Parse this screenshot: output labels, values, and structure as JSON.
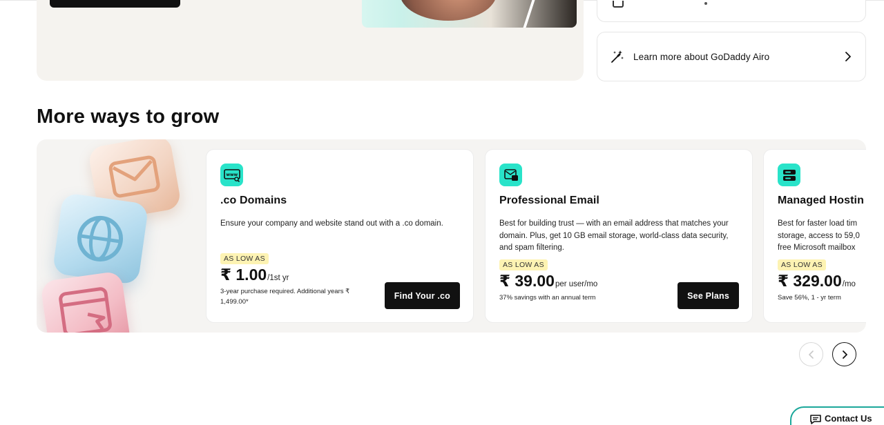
{
  "side": {
    "learn_label": "Learn more about GoDaddy Airo"
  },
  "section_title": "More ways to grow",
  "products": [
    {
      "name": ".co Domains",
      "icon": "www-search-icon",
      "description": "Ensure your company and website stand out with a .co domain.",
      "badge": "AS LOW AS",
      "price": "₹ 1.00",
      "unit": "/1st yr",
      "note": "3-year purchase required. Additional years ₹ 1,499.00*",
      "cta": "Find Your .co"
    },
    {
      "name": "Professional Email",
      "icon": "email-icon",
      "description": "Best for building trust — with an email address that matches your domain. Plus, get 10 GB email storage, world-class data security, and spam filtering.",
      "badge": "AS LOW AS",
      "price": "₹ 39.00",
      "unit": "per user/mo",
      "note": "37% savings with an annual term",
      "cta": "See Plans"
    },
    {
      "name": "Managed Hostin",
      "icon": "server-icon",
      "description": "Best for faster load tim storage, access to 59,0 free Microsoft mailbox",
      "badge": "AS LOW AS",
      "price": "₹ 329.00",
      "unit": "/mo",
      "note": "Save 56%, 1 - yr term"
    }
  ],
  "contact_label": "Contact Us",
  "colors": {
    "accent": "#29e3c9",
    "badge": "#fdf3b3",
    "contact_border": "#1aa79a"
  }
}
